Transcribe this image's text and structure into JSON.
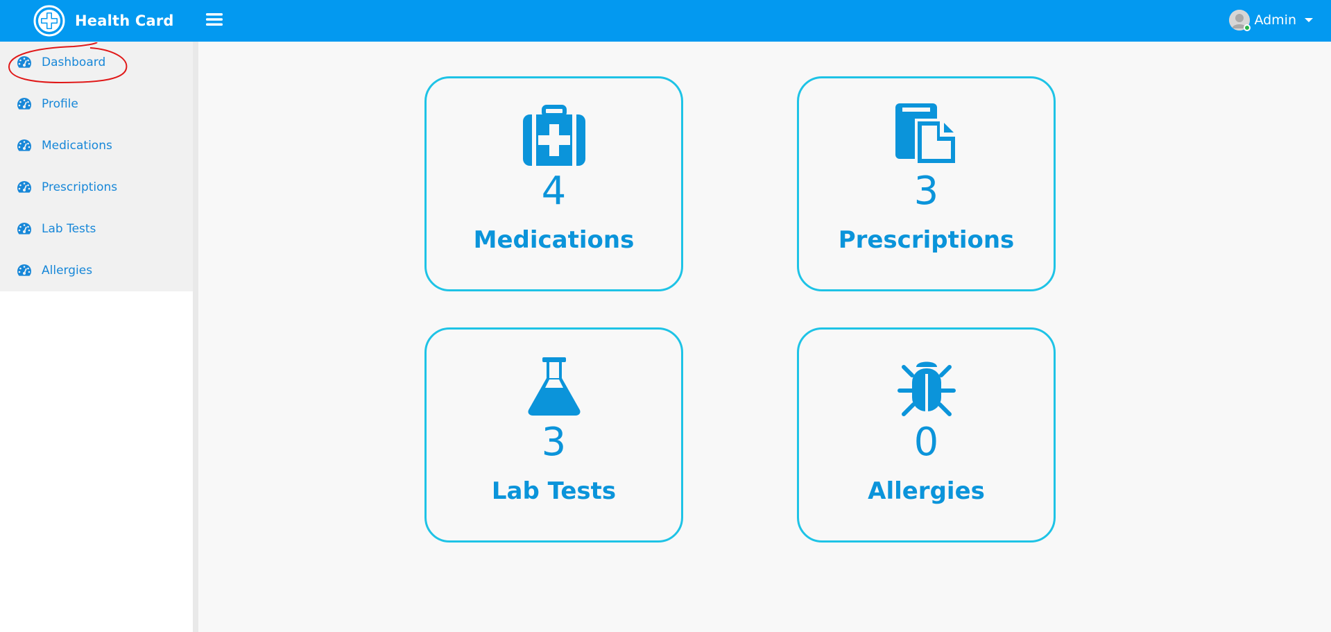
{
  "app": {
    "title": "Health Card"
  },
  "header": {
    "user_name": "Admin"
  },
  "sidebar": {
    "items": [
      {
        "label": "Dashboard"
      },
      {
        "label": "Profile"
      },
      {
        "label": "Medications"
      },
      {
        "label": "Prescriptions"
      },
      {
        "label": "Lab Tests"
      },
      {
        "label": "Allergies"
      }
    ]
  },
  "dashboard": {
    "cards": [
      {
        "count": "4",
        "label": "Medications",
        "icon": "medkit-icon"
      },
      {
        "count": "3",
        "label": "Prescriptions",
        "icon": "copy-icon"
      },
      {
        "count": "3",
        "label": "Lab Tests",
        "icon": "flask-icon"
      },
      {
        "count": "0",
        "label": "Allergies",
        "icon": "bug-icon"
      }
    ]
  },
  "colors": {
    "header_bg": "#0399f0",
    "accent": "#0b94da",
    "card_border": "#1ec3e6",
    "annotation": "#e01818"
  }
}
